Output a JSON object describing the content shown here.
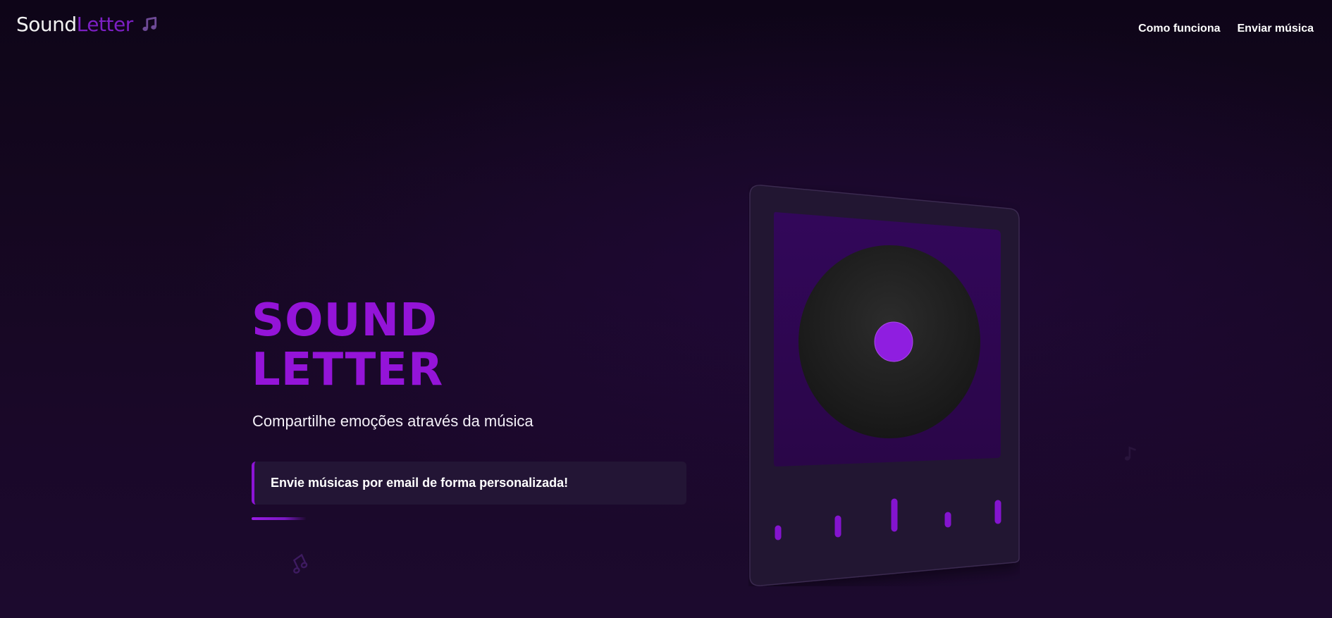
{
  "brand": {
    "name_part1": "Sound",
    "name_part2": "Letter",
    "icon": "music-note-icon"
  },
  "nav": {
    "links": [
      {
        "label": "Como funciona"
      },
      {
        "label": "Enviar música"
      }
    ]
  },
  "hero": {
    "title_line1": "SOUND",
    "title_line2": "LETTER",
    "subtitle": "Compartilhe emoções através da música",
    "promo": "Envie músicas por email de forma personalizada!"
  },
  "colors": {
    "accent": "#9414d8",
    "accent_dark": "#3a0a62",
    "background": "#14071f",
    "card": "#231535",
    "vinyl": "#1c1c1c",
    "vinyl_center": "#8f1ee0"
  },
  "icons": {
    "logo_icon": "music-note-icon",
    "floating_icons": [
      "music-note-icon",
      "music-note-icon"
    ],
    "player_visual": "vinyl-record-icon",
    "equalizer": "equalizer-bars"
  }
}
